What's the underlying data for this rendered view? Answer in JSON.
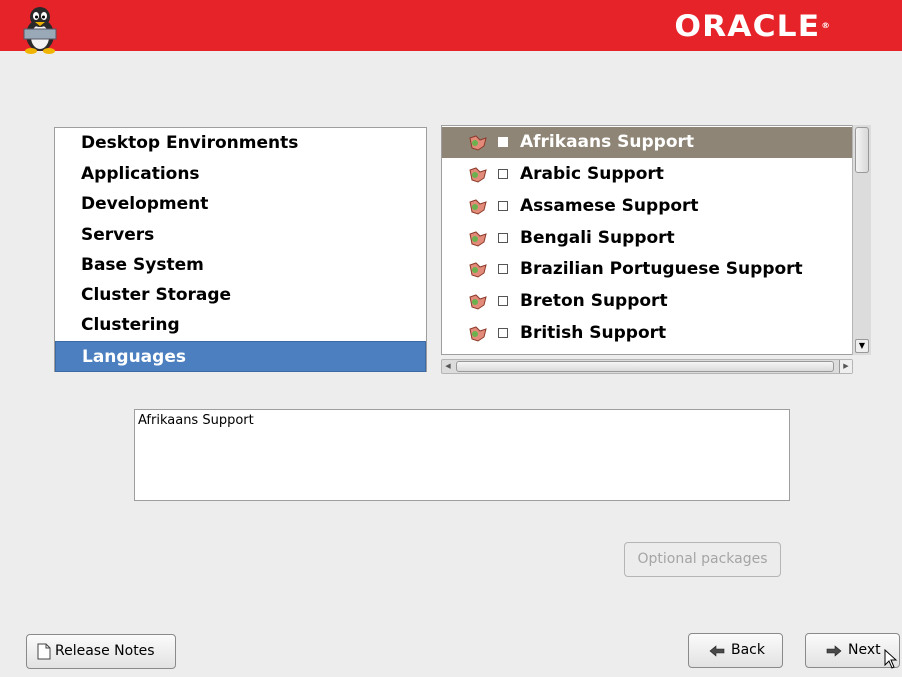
{
  "header": {
    "brand": "ORACLE",
    "mascot": "tux-penguin-icon"
  },
  "categories": [
    {
      "label": "Desktop Environments"
    },
    {
      "label": "Applications"
    },
    {
      "label": "Development"
    },
    {
      "label": "Servers"
    },
    {
      "label": "Base System"
    },
    {
      "label": "Cluster Storage"
    },
    {
      "label": "Clustering"
    },
    {
      "label": "Languages",
      "selected": true
    }
  ],
  "packages": [
    {
      "label": "Afrikaans Support",
      "selected": true,
      "checked": false
    },
    {
      "label": "Arabic Support",
      "checked": false
    },
    {
      "label": "Assamese Support",
      "checked": false
    },
    {
      "label": "Bengali Support",
      "checked": false
    },
    {
      "label": "Brazilian Portuguese Support",
      "checked": false
    },
    {
      "label": "Breton Support",
      "checked": false
    },
    {
      "label": "British Support",
      "checked": false
    }
  ],
  "description": "Afrikaans Support",
  "buttons": {
    "optional_packages": "Optional packages",
    "release_notes": "Release Notes",
    "back": "Back",
    "next": "Next"
  },
  "colors": {
    "header": "#e7232a",
    "category_selected": "#4b7fbf",
    "package_selected": "#8f8576"
  }
}
